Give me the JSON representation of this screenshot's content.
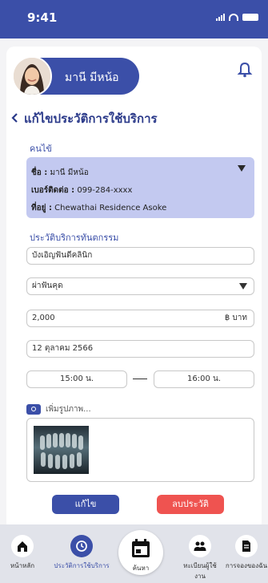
{
  "status": {
    "time": "9:41"
  },
  "user": {
    "name": "มานี มีหน้อ"
  },
  "page": {
    "title": "แก้ไขประวัติการใช้บริการ"
  },
  "patient": {
    "section_label": "คนไข้",
    "name_label": "ชื่อ :",
    "name": "มานี มีหน้อ",
    "phone_label": "เบอร์ติดต่อ :",
    "phone": "099-284-xxxx",
    "address_label": "ที่อยู่ :",
    "address": "Chewathai Residence Asoke"
  },
  "history": {
    "section_label": "ประวัติบริการทันตกรรม",
    "clinic": "บังเอิญฟันดีคลินิก",
    "treatment": "ผ่าฟันคุด",
    "price": "2,000",
    "currency": "฿ บาท",
    "date": "12 ตุลาคม 2566",
    "time_start": "15:00 น.",
    "time_end": "16:00 น.",
    "add_photo_label": "เพิ่มรูปภาพ..."
  },
  "actions": {
    "edit": "แก้ไข",
    "delete": "ลบประวัติ"
  },
  "nav": {
    "home": "หน้าหลัก",
    "history": "ประวัติการใช้บริการ",
    "search": "ค้นหา",
    "register": "ทะเบียนผู้ใช้งาน",
    "booking": "การจองของฉัน"
  },
  "colors": {
    "primary": "#3b4fa8",
    "danger": "#ef5350",
    "patient_card": "#c3c9f0"
  },
  "icons": [
    "bell-icon",
    "back-chevron-icon",
    "dropdown-caret-icon",
    "add-photo-icon",
    "home-icon",
    "history-icon",
    "calendar-icon",
    "users-icon",
    "document-icon"
  ]
}
